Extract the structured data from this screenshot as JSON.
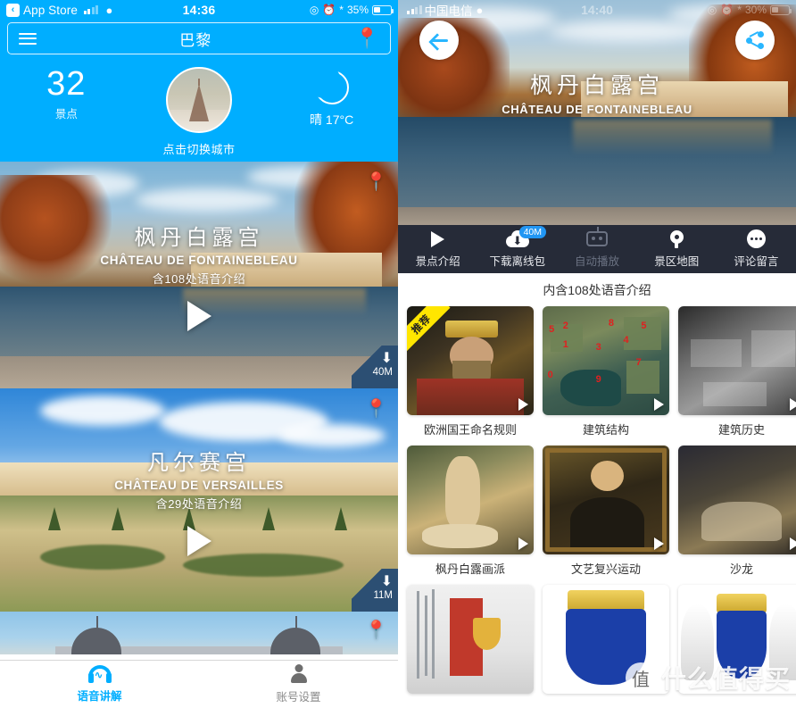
{
  "left": {
    "statusbar": {
      "back_app": "App Store",
      "back_chevron": "chevron-left-icon",
      "signal": "signal-bars-icon",
      "wifi": "wifi-icon",
      "time": "14:36",
      "location_icon": "location-arrow-icon",
      "alarm_icon": "alarm-clock-icon",
      "bluetooth_icon": "bluetooth-icon",
      "battery_pct": "35%",
      "battery_icon": "battery-icon"
    },
    "navbar": {
      "menu_icon": "list-menu-icon",
      "title": "巴黎",
      "pin_icon": "map-pin-icon"
    },
    "summary": {
      "count": "32",
      "count_label": "景点",
      "city_caption": "点击切换城市",
      "city_thumb": "eiffel-tower-thumbnail",
      "weather_icon": "moon-icon",
      "weather_text": "晴 17°C"
    },
    "cards": [
      {
        "cn_title": "枫丹白露宫",
        "fr_title": "CHÂTEAU DE FONTAINEBLEAU",
        "note": "含108处语音介绍",
        "play_icon": "play-icon",
        "pin_icon": "map-pin-icon",
        "download_icon": "download-icon",
        "size": "40M"
      },
      {
        "cn_title": "凡尔赛宫",
        "fr_title": "CHÂTEAU DE VERSAILLES",
        "note": "含29处语音介绍",
        "play_icon": "play-icon",
        "pin_icon": "map-pin-icon",
        "download_icon": "download-icon",
        "size": "11M"
      },
      {
        "cn_title": "",
        "fr_title": "",
        "note": "",
        "play_icon": "play-icon",
        "pin_icon": "map-pin-icon",
        "download_icon": "download-icon",
        "size": ""
      }
    ],
    "tabbar": [
      {
        "label": "语音讲解",
        "icon": "headphones-audio-icon",
        "active": true
      },
      {
        "label": "账号设置",
        "icon": "user-account-icon",
        "active": false
      }
    ]
  },
  "right": {
    "statusbar": {
      "signal": "signal-bars-icon",
      "carrier": "中国电信",
      "wifi": "wifi-icon",
      "time": "14:40",
      "location_icon": "location-arrow-icon",
      "alarm_icon": "alarm-clock-icon",
      "bluetooth_icon": "bluetooth-icon",
      "battery_pct": "30%",
      "battery_icon": "battery-icon"
    },
    "hero": {
      "back_icon": "arrow-left-icon",
      "share_icon": "share-icon",
      "cn_title": "枫丹白露宫",
      "fr_title": "CHÂTEAU DE FONTAINEBLEAU"
    },
    "actions": [
      {
        "label": "景点介绍",
        "icon": "play-icon",
        "badge": "",
        "disabled": false
      },
      {
        "label": "下载离线包",
        "icon": "cloud-download-icon",
        "badge": "40M",
        "disabled": false
      },
      {
        "label": "自动播放",
        "icon": "robot-icon",
        "badge": "",
        "disabled": true
      },
      {
        "label": "景区地图",
        "icon": "map-pin-icon",
        "badge": "",
        "disabled": false
      },
      {
        "label": "评论留言",
        "icon": "ellipsis-icon",
        "badge": "",
        "disabled": false
      }
    ],
    "subnote": "内含108处语音介绍",
    "grid_rows": [
      [
        {
          "label": "欧洲国王命名规则",
          "ribbon": "推荐",
          "art": "king-portrait",
          "play_icon": "play-icon"
        },
        {
          "label": "建筑结构",
          "ribbon": "",
          "art": "aerial-numbered-map",
          "play_icon": "play-icon"
        },
        {
          "label": "建筑历史",
          "ribbon": "",
          "art": "black-white-aerial",
          "play_icon": "play-icon"
        }
      ],
      [
        {
          "label": "枫丹白露画派",
          "ribbon": "",
          "art": "classical-painting",
          "play_icon": "play-icon"
        },
        {
          "label": "文艺复兴运动",
          "ribbon": "",
          "art": "mona-lisa",
          "play_icon": "play-icon"
        },
        {
          "label": "沙龙",
          "ribbon": "",
          "art": "salon-gathering",
          "play_icon": "play-icon"
        }
      ],
      [
        {
          "label": "",
          "ribbon": "",
          "art": "medieval-knight",
          "play_icon": "play-icon"
        },
        {
          "label": "",
          "ribbon": "",
          "art": "fleur-de-lis-arms",
          "play_icon": "play-icon"
        },
        {
          "label": "",
          "ribbon": "",
          "art": "angel-supporters-arms",
          "play_icon": "play-icon"
        }
      ]
    ],
    "watermark": {
      "logo": "值",
      "text": "什么值得买"
    }
  }
}
